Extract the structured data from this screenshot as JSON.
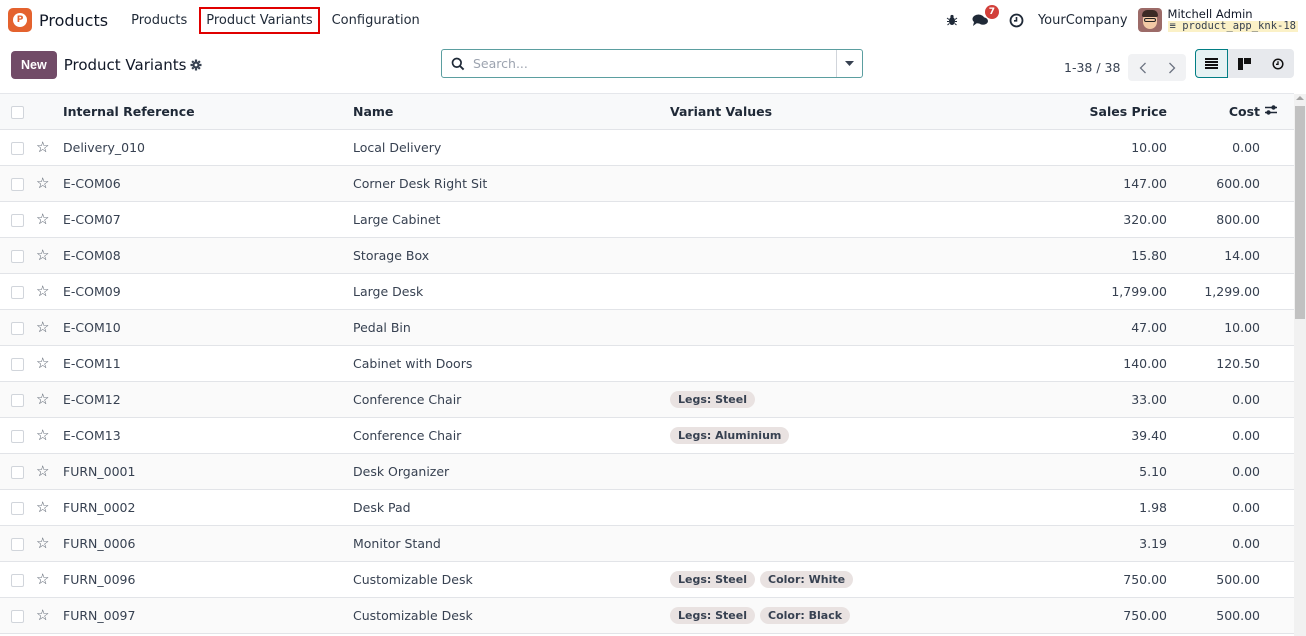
{
  "navbar": {
    "app_name": "Products",
    "logo_letter": "P",
    "menu": [
      {
        "label": "Products"
      },
      {
        "label": "Product Variants"
      },
      {
        "label": "Configuration"
      }
    ],
    "messages_count": "7",
    "company": "YourCompany",
    "user_name": "Mitchell Admin",
    "database": "product_app_knk-18"
  },
  "control_panel": {
    "new_label": "New",
    "title": "Product Variants",
    "search_placeholder": "Search...",
    "pager_value": "1-38 / 38"
  },
  "table": {
    "columns": {
      "ref": "Internal Reference",
      "name": "Name",
      "variants": "Variant Values",
      "price": "Sales Price",
      "cost": "Cost"
    },
    "rows": [
      {
        "ref": "Delivery_010",
        "name": "Local Delivery",
        "variants": [],
        "price": "10.00",
        "cost": "0.00"
      },
      {
        "ref": "E-COM06",
        "name": "Corner Desk Right Sit",
        "variants": [],
        "price": "147.00",
        "cost": "600.00"
      },
      {
        "ref": "E-COM07",
        "name": "Large Cabinet",
        "variants": [],
        "price": "320.00",
        "cost": "800.00"
      },
      {
        "ref": "E-COM08",
        "name": "Storage Box",
        "variants": [],
        "price": "15.80",
        "cost": "14.00"
      },
      {
        "ref": "E-COM09",
        "name": "Large Desk",
        "variants": [],
        "price": "1,799.00",
        "cost": "1,299.00"
      },
      {
        "ref": "E-COM10",
        "name": "Pedal Bin",
        "variants": [],
        "price": "47.00",
        "cost": "10.00"
      },
      {
        "ref": "E-COM11",
        "name": "Cabinet with Doors",
        "variants": [],
        "price": "140.00",
        "cost": "120.50"
      },
      {
        "ref": "E-COM12",
        "name": "Conference Chair",
        "variants": [
          "Legs: Steel"
        ],
        "price": "33.00",
        "cost": "0.00"
      },
      {
        "ref": "E-COM13",
        "name": "Conference Chair",
        "variants": [
          "Legs: Aluminium"
        ],
        "price": "39.40",
        "cost": "0.00"
      },
      {
        "ref": "FURN_0001",
        "name": "Desk Organizer",
        "variants": [],
        "price": "5.10",
        "cost": "0.00"
      },
      {
        "ref": "FURN_0002",
        "name": "Desk Pad",
        "variants": [],
        "price": "1.98",
        "cost": "0.00"
      },
      {
        "ref": "FURN_0006",
        "name": "Monitor Stand",
        "variants": [],
        "price": "3.19",
        "cost": "0.00"
      },
      {
        "ref": "FURN_0096",
        "name": "Customizable Desk",
        "variants": [
          "Legs: Steel",
          "Color: White"
        ],
        "price": "750.00",
        "cost": "500.00"
      },
      {
        "ref": "FURN_0097",
        "name": "Customizable Desk",
        "variants": [
          "Legs: Steel",
          "Color: Black"
        ],
        "price": "750.00",
        "cost": "500.00"
      }
    ]
  },
  "colors": {
    "brand": "#714b67",
    "app_logo": "#e4622e",
    "accent": "#017e84",
    "badge": "#d23f3a",
    "highlight_box": "#e00000"
  }
}
